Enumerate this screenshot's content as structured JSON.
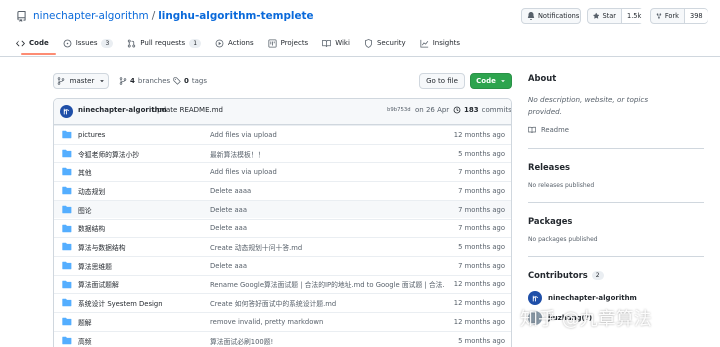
{
  "repo": {
    "owner": "ninechapter-algorithm",
    "separator": "/",
    "name": "linghu-algorithm-templete",
    "notifications_label": "Notifications",
    "star_label": "Star",
    "star_count": "1.5k",
    "fork_label": "Fork",
    "fork_count": "398"
  },
  "tabs": [
    {
      "label": "Code",
      "icon": "code-icon",
      "active": true
    },
    {
      "label": "Issues",
      "icon": "issue-icon",
      "count": "3"
    },
    {
      "label": "Pull requests",
      "icon": "pull-request-icon",
      "count": "1"
    },
    {
      "label": "Actions",
      "icon": "play-icon"
    },
    {
      "label": "Projects",
      "icon": "project-icon"
    },
    {
      "label": "Wiki",
      "icon": "book-icon"
    },
    {
      "label": "Security",
      "icon": "shield-icon"
    },
    {
      "label": "Insights",
      "icon": "graph-icon"
    }
  ],
  "toolbar": {
    "branch": "master",
    "branches_count": "4",
    "branches_label": "branches",
    "tags_count": "0",
    "tags_label": "tags",
    "goto_file": "Go to file",
    "code_button": "Code"
  },
  "latest_commit": {
    "author": "ninechapter-algorithm",
    "message": "Update README.md",
    "hash": "b9b753d",
    "date": "on 26 Apr",
    "commits_count": "183",
    "commits_label": "commits"
  },
  "files": [
    {
      "name": "pictures",
      "message": "Add files via upload",
      "age": "12 months ago"
    },
    {
      "name": "令狐老师的算法小抄",
      "message": "最新算法模板！！",
      "age": "5 months ago"
    },
    {
      "name": "其他",
      "message": "Add files via upload",
      "age": "7 months ago"
    },
    {
      "name": "动态规划",
      "message": "Delete aaaa",
      "age": "7 months ago"
    },
    {
      "name": "图论",
      "message": "Delete aaa",
      "age": "7 months ago",
      "highlight": true
    },
    {
      "name": "数据结构",
      "message": "Delete aaa",
      "age": "7 months ago"
    },
    {
      "name": "算法与数据结构",
      "message": "Create 动态规划十问十答.md",
      "age": "5 months ago"
    },
    {
      "name": "算法思维题",
      "message": "Delete aaa",
      "age": "7 months ago"
    },
    {
      "name": "算法面试题解",
      "message": "Rename Google算法面试题 | 合法的IP的地址.md to Google 面试题 | 合法…",
      "age": "12 months ago"
    },
    {
      "name": "系统设计 Syestem Design",
      "message": "Create 如何答好面试中的系统设计题.md",
      "age": "12 months ago"
    },
    {
      "name": "题解",
      "message": "remove invalid, pretty markdown",
      "age": "12 months ago"
    },
    {
      "name": "高频",
      "message": "算法面试必刷100题!",
      "age": "5 months ago"
    }
  ],
  "sidebar": {
    "about_title": "About",
    "about_text_1": "No description, website, or topics",
    "about_text_2": "provided.",
    "readme_label": "Readme",
    "releases_title": "Releases",
    "releases_text": "No releases published",
    "packages_title": "Packages",
    "packages_text": "No packages published",
    "contributors_title": "Contributors",
    "contributors_count": "2",
    "contributors": [
      {
        "name": "ninechapter-algorithm"
      },
      {
        "name": "jiuzhang(?)"
      }
    ]
  },
  "watermark": "知乎 @九章算法",
  "colors": {
    "link": "#0969da",
    "green": "#2da44e",
    "folder": "#54aeff",
    "active_tab": "#fd8c73"
  }
}
